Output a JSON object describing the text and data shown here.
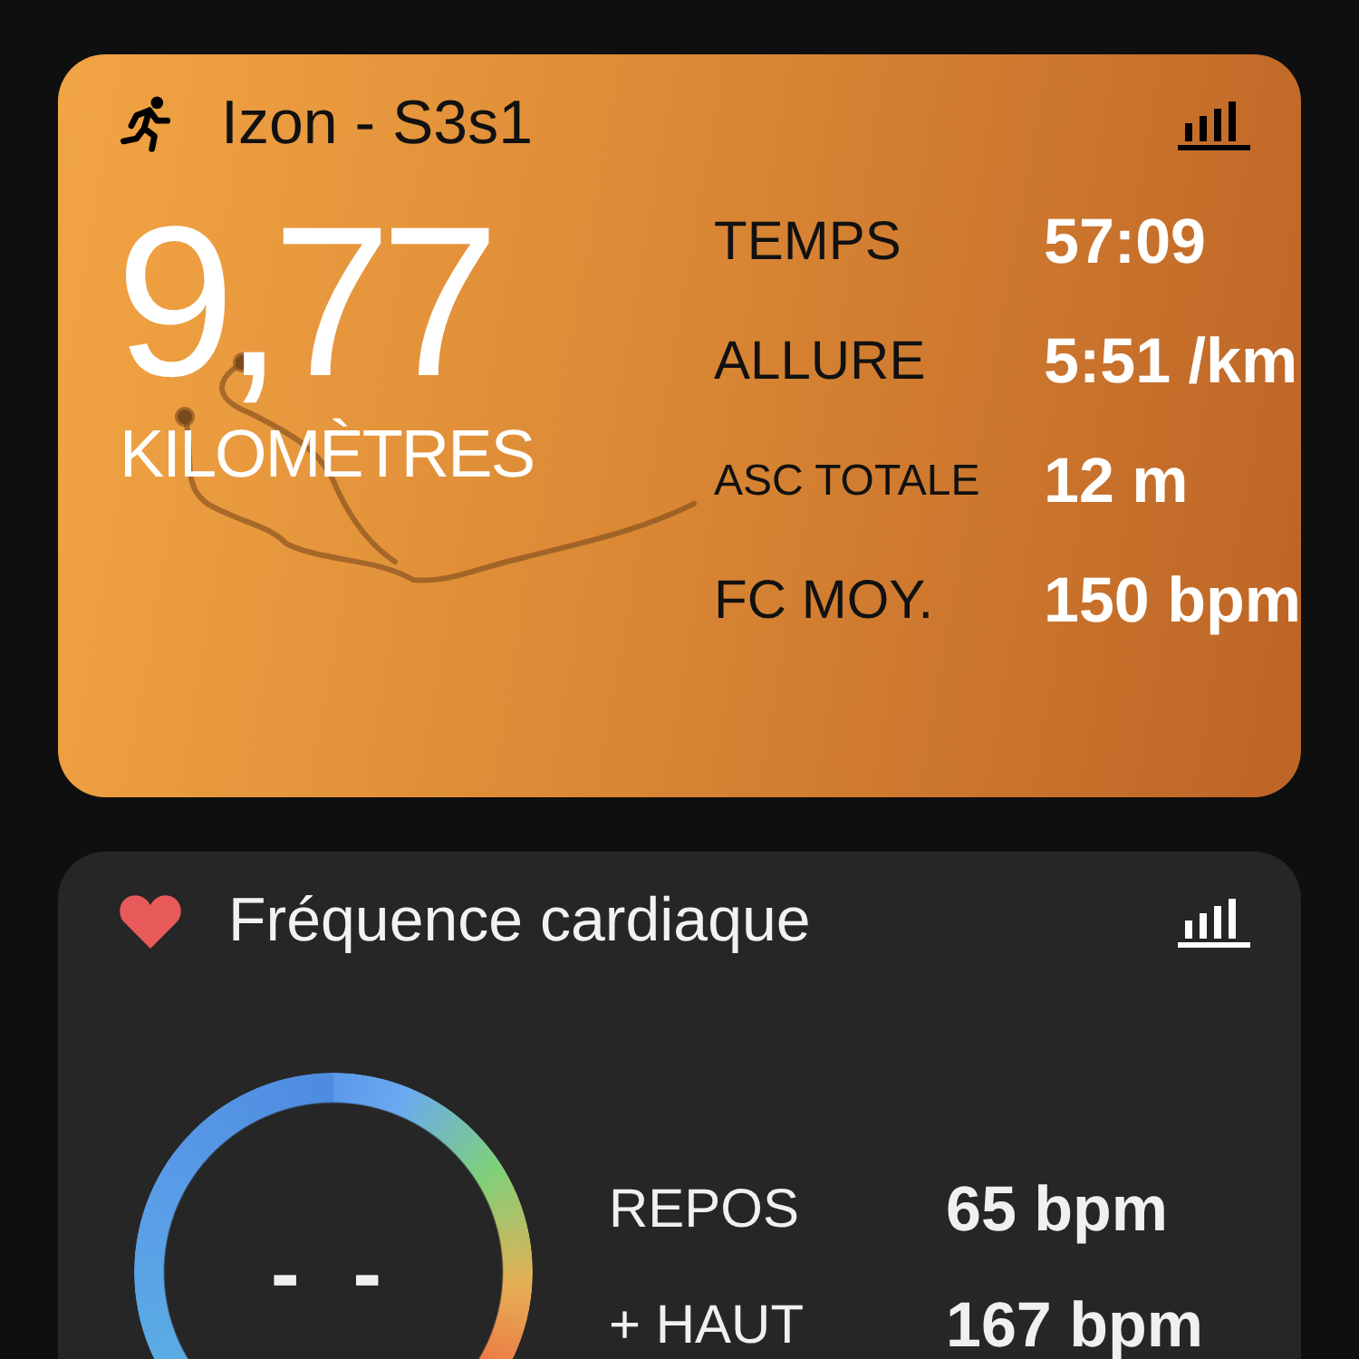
{
  "activity_card": {
    "title": "Izon - S3s1",
    "distance": "9,77",
    "distance_unit": "KILOMÈTRES",
    "stats": [
      {
        "label": "TEMPS",
        "value": "57:09",
        "kind": "normal"
      },
      {
        "label": "ALLURE",
        "value": "5:51 /km",
        "kind": "normal"
      },
      {
        "label": "ASC TOTALE",
        "value": "12 m",
        "kind": "small"
      },
      {
        "label": "FC MOY.",
        "value": "150 bpm",
        "kind": "normal"
      }
    ]
  },
  "heart_card": {
    "title": "Fréquence cardiaque",
    "gauge_value": "- -",
    "stats": [
      {
        "label": "REPOS",
        "value": "65 bpm"
      },
      {
        "label": "+ HAUT",
        "value": "167 bpm"
      }
    ]
  }
}
